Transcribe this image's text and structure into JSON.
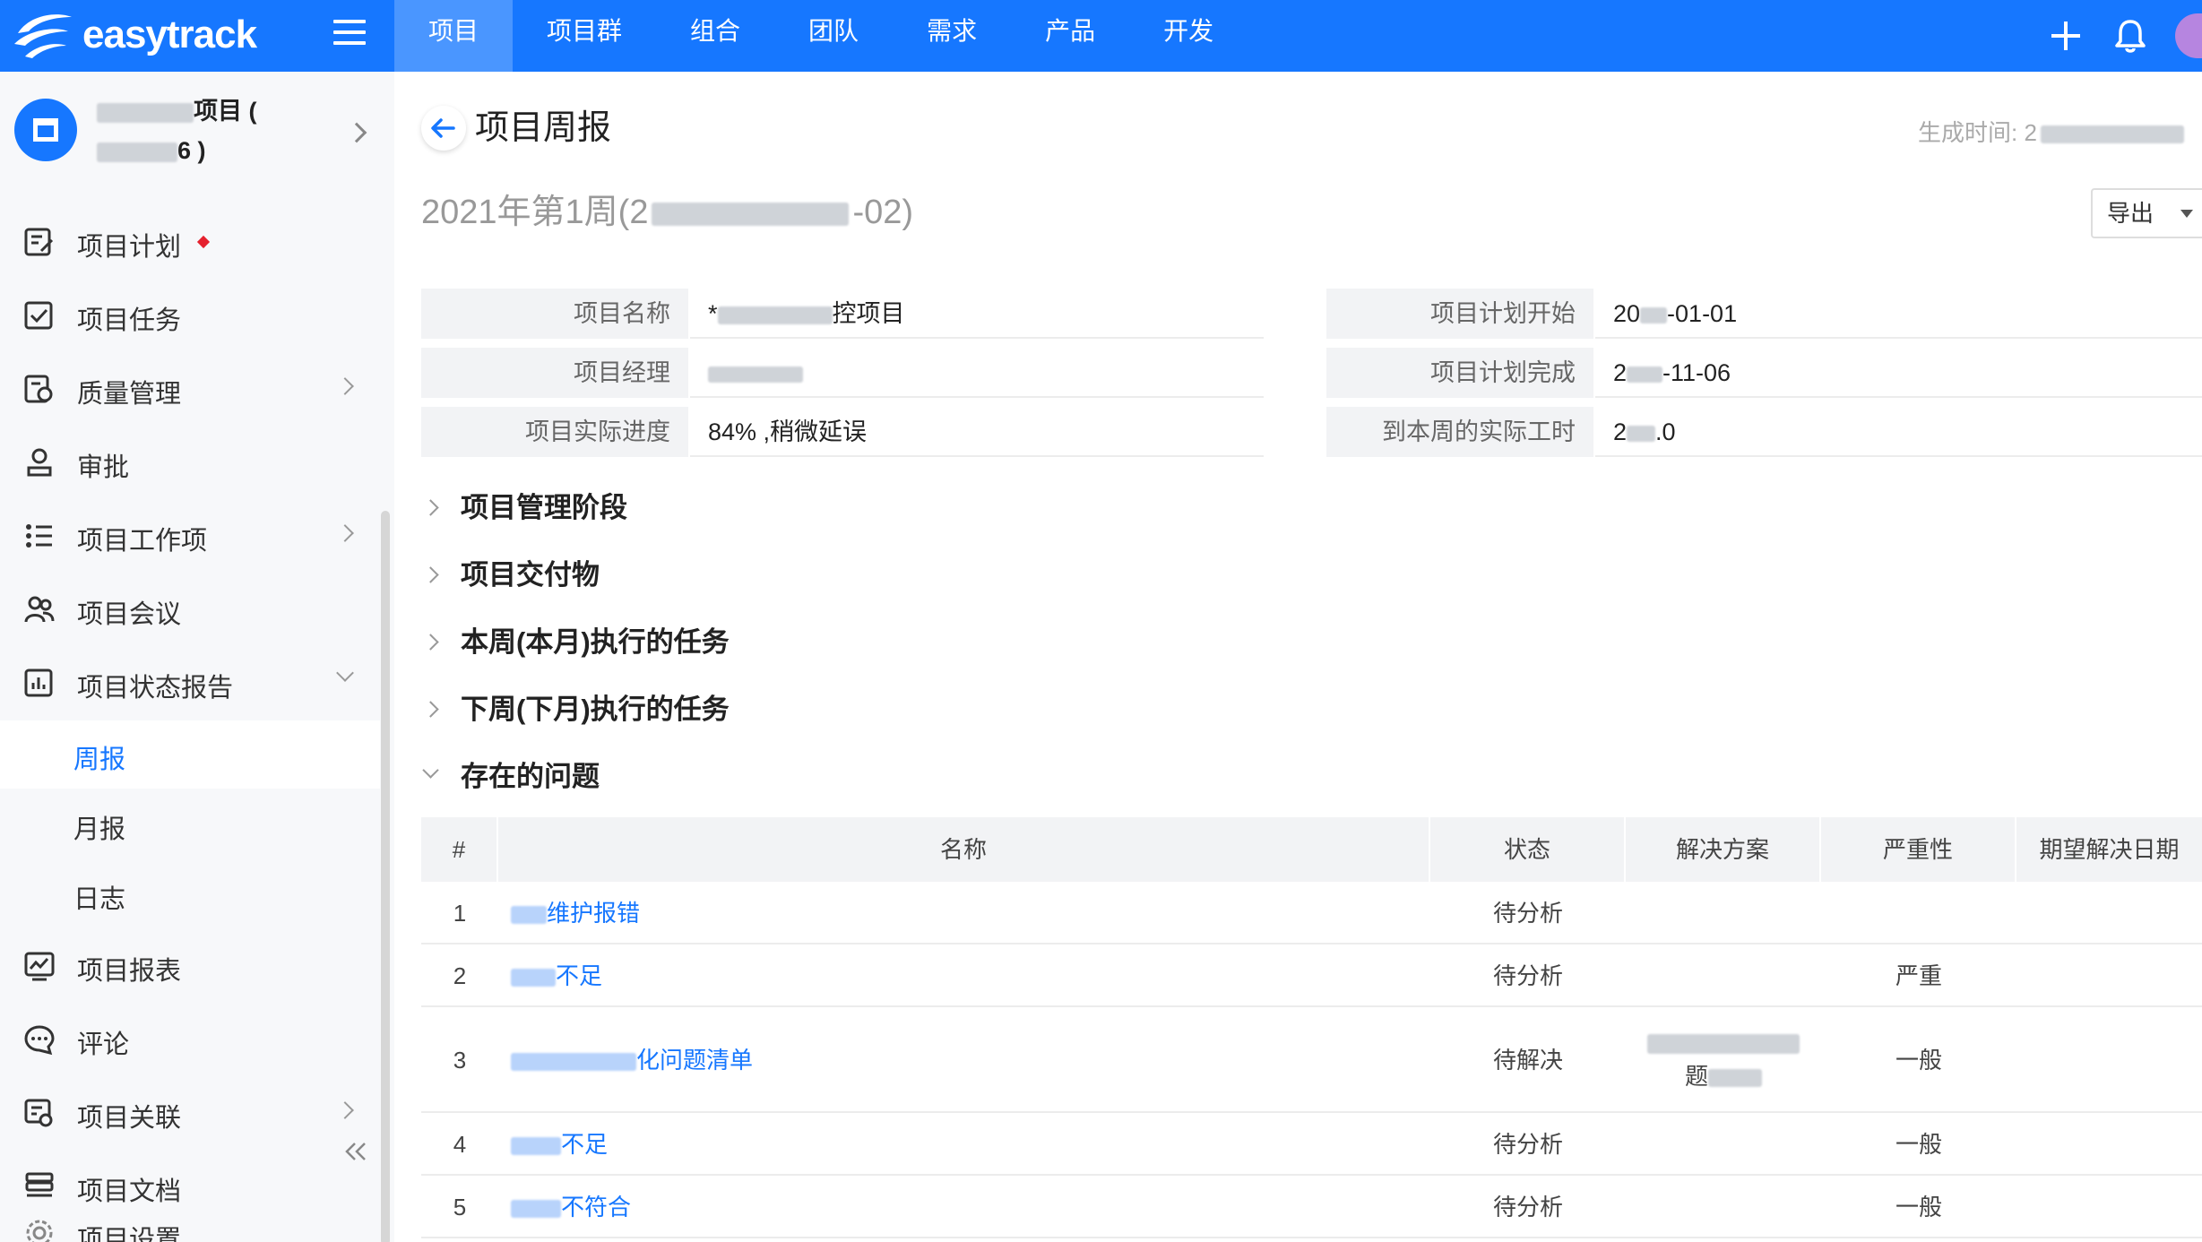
{
  "app": {
    "logo_text": "easytrack"
  },
  "nav": {
    "items": [
      "项目",
      "项目群",
      "组合",
      "团队",
      "需求",
      "产品",
      "开发"
    ],
    "active_index": 0
  },
  "sidebar": {
    "project_name_line1_suffix": "项目 (",
    "project_name_line2_suffix": "6 )",
    "items": [
      {
        "label": "项目计划",
        "icon": "plan-icon"
      },
      {
        "label": "项目任务",
        "icon": "task-check-icon"
      },
      {
        "label": "质量管理",
        "icon": "quality-icon"
      },
      {
        "label": "审批",
        "icon": "user-approval-icon"
      },
      {
        "label": "项目工作项",
        "icon": "list-icon"
      },
      {
        "label": "项目会议",
        "icon": "people-icon"
      },
      {
        "label": "项目状态报告",
        "icon": "report-chart-icon"
      },
      {
        "label": "项目报表",
        "icon": "chart-icon"
      },
      {
        "label": "评论",
        "icon": "comment-icon"
      },
      {
        "label": "项目关联",
        "icon": "link-icon"
      },
      {
        "label": "项目文档",
        "icon": "document-icon"
      },
      {
        "label": "项目设置",
        "icon": "gear-icon"
      }
    ],
    "sub_items": [
      {
        "label": "周报",
        "active": true
      },
      {
        "label": "月报",
        "active": false
      },
      {
        "label": "日志",
        "active": false
      }
    ]
  },
  "main": {
    "page_title": "项目周报",
    "gen_time_label": "生成时间: 2",
    "week_title_prefix": "2021年第1周(2",
    "week_title_suffix": "-02)",
    "export_label": "导出",
    "info": {
      "project_name_label": "项目名称",
      "project_name_value_prefix": "*",
      "project_name_value_suffix": "控项目",
      "manager_label": "项目经理",
      "progress_label": "项目实际进度",
      "progress_value": "84% ,稍微延误",
      "plan_start_label": "项目计划开始",
      "plan_start_value_prefix": "20",
      "plan_start_value_suffix": "-01-01",
      "plan_end_label": "项目计划完成",
      "plan_end_value_prefix": "2",
      "plan_end_value_suffix": "-11-06",
      "hours_label": "到本周的实际工时",
      "hours_value_prefix": "2",
      "hours_value_suffix": ".0"
    },
    "sections": [
      {
        "label": "项目管理阶段",
        "expanded": false
      },
      {
        "label": "项目交付物",
        "expanded": false
      },
      {
        "label": "本周(本月)执行的任务",
        "expanded": false
      },
      {
        "label": "下周(下月)执行的任务",
        "expanded": false
      },
      {
        "label": "存在的问题",
        "expanded": true
      }
    ],
    "issues_table": {
      "columns": [
        "#",
        "名称",
        "状态",
        "解决方案",
        "严重性",
        "期望解决日期"
      ],
      "rows": [
        {
          "no": "1",
          "name": "维护报错",
          "status": "待分析",
          "solution": "",
          "severity": "",
          "due": ""
        },
        {
          "no": "2",
          "name": "不足",
          "status": "待分析",
          "solution": "",
          "severity": "严重",
          "due": ""
        },
        {
          "no": "3",
          "name": "化问题清单",
          "status": "待解决",
          "solution": "题",
          "severity": "一般",
          "due": ""
        },
        {
          "no": "4",
          "name": "不足",
          "status": "待分析",
          "solution": "",
          "severity": "一般",
          "due": ""
        },
        {
          "no": "5",
          "name": "不符合",
          "status": "待分析",
          "solution": "",
          "severity": "一般",
          "due": ""
        }
      ]
    }
  },
  "colors": {
    "brand_blue": "#1677ff",
    "active_nav_bg": "#4a96ff",
    "sidebar_bg": "#f7f8fa",
    "red_marker": "#e5212e"
  }
}
